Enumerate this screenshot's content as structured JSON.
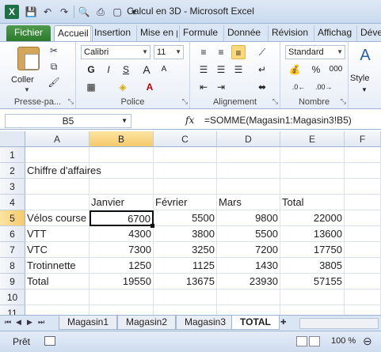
{
  "window": {
    "title": "Calcul en 3D - Microsoft Excel",
    "app_icon": "X"
  },
  "qat": [
    "save-icon",
    "undo-icon",
    "redo-icon",
    "print-preview-icon",
    "print-icon",
    "new-icon",
    "customize-icon"
  ],
  "tabs": [
    "Fichier",
    "Accueil",
    "Insertion",
    "Mise en p",
    "Formule",
    "Donnée",
    "Révision",
    "Affichag",
    "Déve"
  ],
  "ribbon": {
    "clipboard": {
      "paste": "Coller",
      "label": "Presse-pa..."
    },
    "font": {
      "name": "Calibri",
      "size": "11",
      "bold": "G",
      "italic": "I",
      "underline": "S",
      "grow": "A",
      "shrink": "A",
      "label": "Police"
    },
    "alignment": {
      "label": "Alignement"
    },
    "number": {
      "format": "Standard",
      "percent": "%",
      "thousands": "000",
      "label": "Nombre"
    },
    "styles": {
      "label": "Style"
    }
  },
  "formula_bar": {
    "name_box": "B5",
    "fx": "fx",
    "formula": "=SOMME(Magasin1:Magasin3!B5)"
  },
  "columns": [
    "A",
    "B",
    "C",
    "D",
    "E",
    "F"
  ],
  "rows": [
    "1",
    "2",
    "3",
    "4",
    "5",
    "6",
    "7",
    "8",
    "9",
    "10",
    "11"
  ],
  "cells": {
    "A2": "Chiffre d'affaires",
    "B4": "Janvier",
    "C4": "Février",
    "D4": "Mars",
    "E4": "Total",
    "A5": "Vélos course",
    "B5": "6700",
    "C5": "5500",
    "D5": "9800",
    "E5": "22000",
    "A6": "VTT",
    "B6": "4300",
    "C6": "3800",
    "D6": "5500",
    "E6": "13600",
    "A7": "VTC",
    "B7": "7300",
    "C7": "3250",
    "D7": "7200",
    "E7": "17750",
    "A8": "Trotinnette",
    "B8": "1250",
    "C8": "1125",
    "D8": "1430",
    "E8": "3805",
    "A9": "Total",
    "B9": "19550",
    "C9": "13675",
    "D9": "23930",
    "E9": "57155"
  },
  "sheets": [
    "Magasin1",
    "Magasin2",
    "Magasin3",
    "TOTAL"
  ],
  "active_sheet": "TOTAL",
  "status": {
    "ready": "Prêt",
    "zoom": "100 %"
  }
}
